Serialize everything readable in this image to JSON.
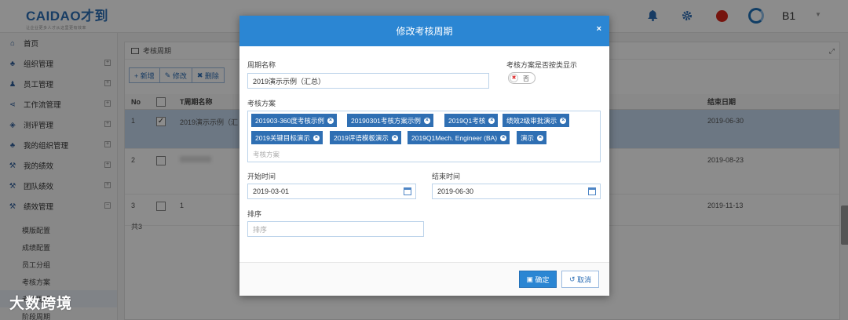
{
  "header": {
    "logo_main": "CAIDAO才到",
    "logo_sub": "让企业更多人才从这里更有效率",
    "user": "B1"
  },
  "sidebar": {
    "items": [
      {
        "label": "首页",
        "icon": "home-icon",
        "expandable": false
      },
      {
        "label": "组织管理",
        "icon": "org-icon",
        "expandable": true
      },
      {
        "label": "员工管理",
        "icon": "users-icon",
        "expandable": true
      },
      {
        "label": "工作流管理",
        "icon": "share-icon",
        "expandable": true
      },
      {
        "label": "测评管理",
        "icon": "cubes-icon",
        "expandable": true
      },
      {
        "label": "我的组织管理",
        "icon": "org-icon",
        "expandable": true
      },
      {
        "label": "我的绩效",
        "icon": "gavel-icon",
        "expandable": true
      },
      {
        "label": "团队绩效",
        "icon": "gavel-icon",
        "expandable": true
      },
      {
        "label": "绩效管理",
        "icon": "gavel-icon",
        "expandable": true
      }
    ],
    "subitems": [
      "模版配置",
      "成绩配置",
      "员工分组",
      "考核方案",
      "考核周期",
      "阶段周期"
    ]
  },
  "panel": {
    "title": "考核周期",
    "toolbar": {
      "add": "+ 新增",
      "edit": "修改",
      "delete": "删除"
    },
    "columns": {
      "no": "No",
      "name": "T周期名称",
      "end": "结束日期"
    },
    "rows": [
      {
        "no": "1",
        "checked": true,
        "name": "2019演示示例（汇",
        "end": "2019-06-30"
      },
      {
        "no": "2",
        "checked": false,
        "name": "",
        "end": "2019-08-23"
      },
      {
        "no": "3",
        "checked": false,
        "name": "1",
        "end": "2019-11-13"
      }
    ],
    "footer": "共3"
  },
  "modal": {
    "title": "修改考核周期",
    "close": "×",
    "name_label": "周期名称",
    "name_value": "2019演示示例（汇总）",
    "classify_label": "考核方案是否按类显示",
    "toggle_text": "否",
    "plans_label": "考核方案",
    "tags": [
      "201903-360度考核示例",
      "20190301考核方案示例",
      "2019Q1考核",
      "绩效2级审批演示",
      "2019关键目标演示",
      "2019评语模板演示",
      "2019Q1Mech. Engineer (BA)",
      "演示"
    ],
    "plans_placeholder": "考核方案",
    "start_label": "开始时间",
    "start_value": "2019-03-01",
    "end_label": "结束时间",
    "end_value": "2019-06-30",
    "order_label": "排序",
    "order_placeholder": "排序",
    "ok": "确定",
    "cancel": "取消"
  },
  "watermark": "大数跨境",
  "colors": {
    "primary": "#2b86d3",
    "tag": "#2f6fb3",
    "selected_row": "#c5d9ef"
  }
}
